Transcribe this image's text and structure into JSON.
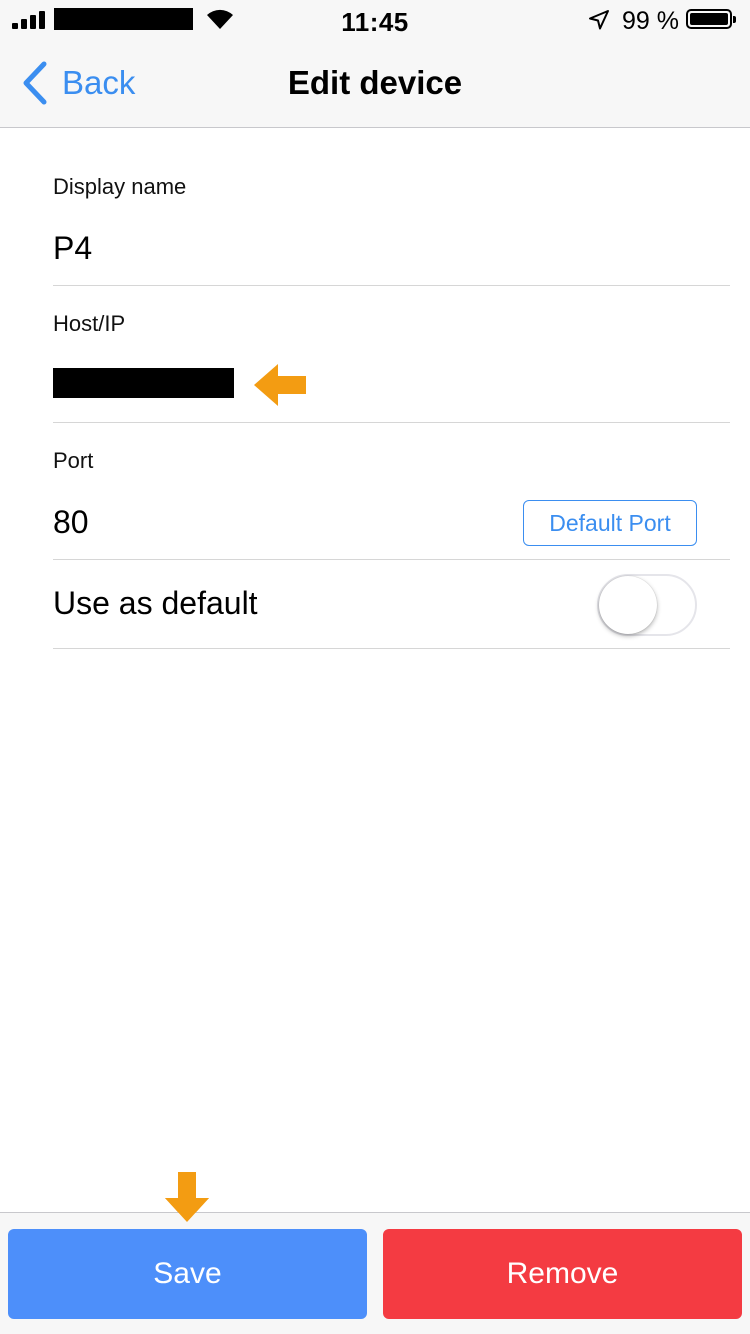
{
  "status_bar": {
    "time": "11:45",
    "battery_percent": "99 %",
    "battery_level": 0.99
  },
  "nav": {
    "back_label": "Back",
    "title": "Edit device"
  },
  "form": {
    "display_name": {
      "label": "Display name",
      "value": "P4"
    },
    "host": {
      "label": "Host/IP",
      "value": ""
    },
    "port": {
      "label": "Port",
      "value": "80",
      "default_port_label": "Default Port"
    },
    "use_as_default": {
      "label": "Use as default",
      "enabled": false
    }
  },
  "actions": {
    "save_label": "Save",
    "remove_label": "Remove"
  },
  "colors": {
    "accent": "#3b8ef0",
    "save": "#4d8ffa",
    "remove": "#f43b42",
    "annotation_arrow": "#f39c12"
  }
}
